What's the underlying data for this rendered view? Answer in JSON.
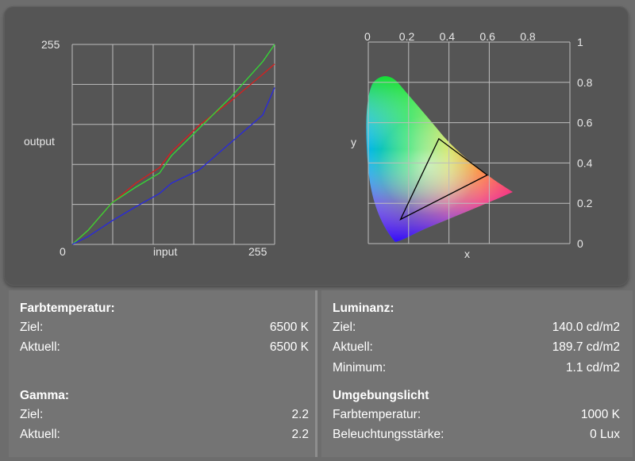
{
  "curve_chart": {
    "y_max_label": "255",
    "y_axis_label": "output",
    "x_min_label": "0",
    "x_axis_label": "input",
    "x_max_label": "255",
    "series_colors": {
      "red": "#d42020",
      "green": "#36d436",
      "blue": "#2a2ad8"
    },
    "chart_data": {
      "type": "line",
      "xlim": [
        0,
        255
      ],
      "ylim": [
        0,
        255
      ],
      "series": [
        {
          "color": "#d42020",
          "x": [
            0,
            20,
            50,
            80,
            110,
            125,
            160,
            200,
            240,
            255
          ],
          "y": [
            0,
            18,
            53,
            78,
            98,
            118,
            152,
            183,
            217,
            230
          ]
        },
        {
          "color": "#36d436",
          "x": [
            0,
            20,
            50,
            80,
            110,
            125,
            160,
            200,
            240,
            255
          ],
          "y": [
            0,
            18,
            53,
            73,
            91,
            113,
            148,
            188,
            233,
            255
          ]
        },
        {
          "color": "#2a2ad8",
          "x": [
            0,
            20,
            50,
            80,
            110,
            125,
            160,
            200,
            240,
            255
          ],
          "y": [
            0,
            10,
            30,
            48,
            65,
            78,
            95,
            130,
            165,
            200
          ]
        }
      ]
    }
  },
  "cie_chart": {
    "top_ticks": [
      "0",
      "0.2",
      "0.4",
      "0.6",
      "0.8"
    ],
    "right_ticks": [
      "1",
      "0.8",
      "0.6",
      "0.4",
      "0.2",
      "0"
    ],
    "x_axis_label": "x",
    "y_axis_label": "y",
    "gamut_triangle": [
      [
        0.35,
        0.52
      ],
      [
        0.59,
        0.34
      ],
      [
        0.16,
        0.12
      ]
    ],
    "gamut_color": "#000000"
  },
  "farbtemperatur": {
    "title": "Farbtemperatur:",
    "rows": [
      {
        "label": "Ziel:",
        "value": "6500 K"
      },
      {
        "label": "Aktuell:",
        "value": "6500 K"
      }
    ]
  },
  "gamma": {
    "title": "Gamma:",
    "rows": [
      {
        "label": "Ziel:",
        "value": "2.2"
      },
      {
        "label": "Aktuell:",
        "value": "2.2"
      }
    ]
  },
  "luminanz": {
    "title": "Luminanz:",
    "rows": [
      {
        "label": "Ziel:",
        "value": "140.0 cd/m2"
      },
      {
        "label": "Aktuell:",
        "value": "189.7 cd/m2"
      },
      {
        "label": "Minimum:",
        "value": "1.1 cd/m2"
      }
    ]
  },
  "umgebungslicht": {
    "title": "Umgebungslicht",
    "rows": [
      {
        "label": "Farbtemperatur:",
        "value": "1000 K"
      },
      {
        "label": "Beleuchtungsstärke:",
        "value": "0 Lux"
      }
    ]
  }
}
